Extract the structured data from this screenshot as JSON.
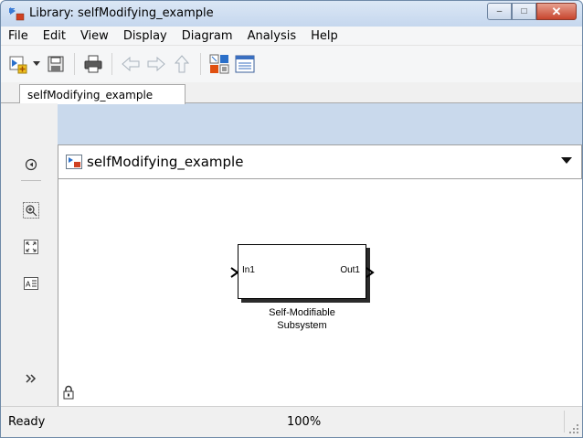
{
  "window": {
    "title": "Library: selfModifying_example",
    "controls": {
      "minimize": "–",
      "maximize": "□",
      "close": "✕"
    }
  },
  "menu": [
    "File",
    "Edit",
    "View",
    "Display",
    "Diagram",
    "Analysis",
    "Help"
  ],
  "toolbar": {
    "icons": [
      "new-library-icon",
      "dropdown-arrow-icon",
      "save-icon",
      "print-icon",
      "back-arrow-icon",
      "forward-arrow-icon",
      "up-arrow-icon",
      "library-browser-icon",
      "model-explorer-icon"
    ]
  },
  "tab": {
    "label": "selfModifying_example"
  },
  "address": {
    "path": "selfModifying_example"
  },
  "block": {
    "input_port": "In1",
    "output_port": "Out1",
    "name_line1": "Self-Modifiable",
    "name_line2": "Subsystem"
  },
  "status": {
    "state": "Ready",
    "zoom": "100%"
  },
  "colors": {
    "titlebar": "#c5d7ee",
    "close_button": "#c7452e",
    "canvas": "#ffffff"
  }
}
